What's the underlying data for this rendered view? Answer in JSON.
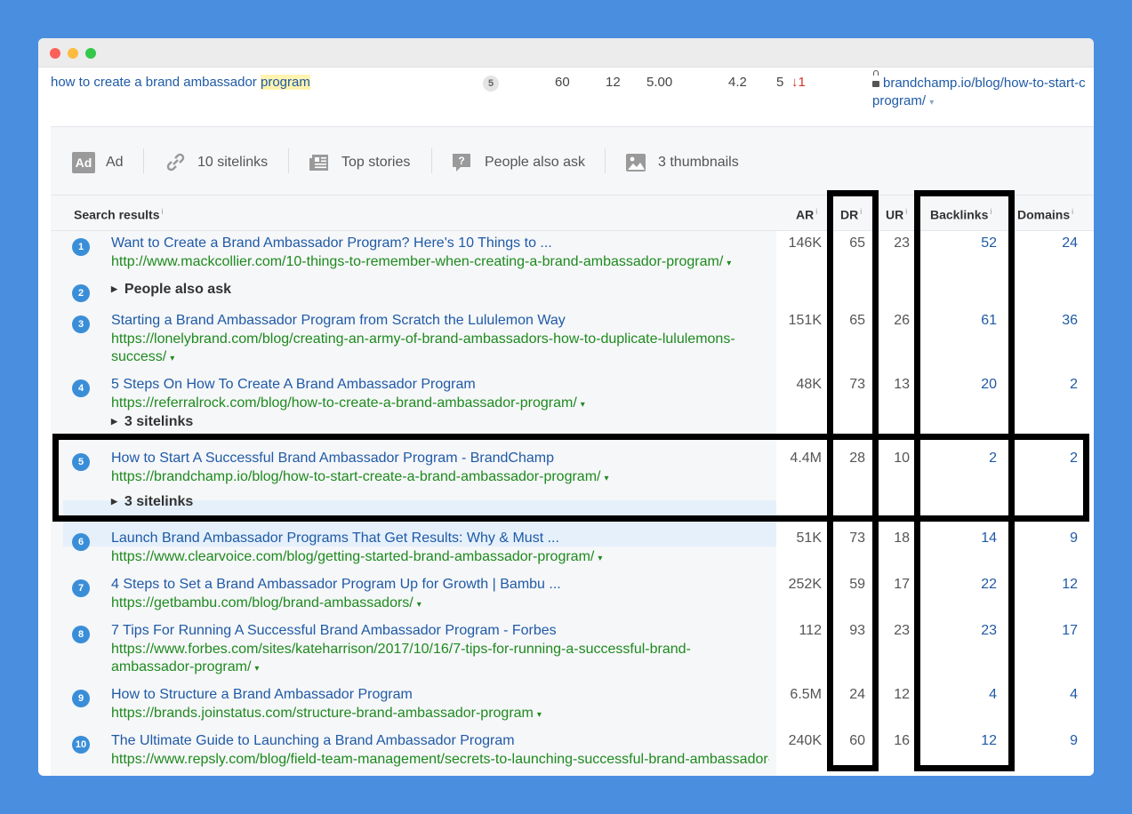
{
  "keyword_row": {
    "keyword_prefix": "how to create a brand ambassador ",
    "keyword_highlight": "program",
    "badge": "5",
    "values": [
      "60",
      "12",
      "5.00",
      "4.2",
      "5"
    ],
    "change": "↓1",
    "url_line1": "brandchamp.io/blog/how-to-start-c",
    "url_line2": "program/",
    "url_caret": "▾"
  },
  "serp_features": [
    {
      "label": "Ad",
      "icon": "ad-icon"
    },
    {
      "label": "10 sitelinks",
      "icon": "link-icon"
    },
    {
      "label": "Top stories",
      "icon": "news-icon"
    },
    {
      "label": "People also ask",
      "icon": "question-icon"
    },
    {
      "label": "3 thumbnails",
      "icon": "image-icon"
    }
  ],
  "ad_icon_text": "Ad",
  "columns": {
    "search_results": "Search results",
    "ar": "AR",
    "dr": "DR",
    "ur": "UR",
    "backlinks": "Backlinks",
    "domains": "Domains",
    "info": "i"
  },
  "results": [
    {
      "rank": "1",
      "title": "Want to Create a Brand Ambassador Program? Here's 10 Things to ...",
      "url": "http://www.mackcollier.com/10-things-to-remember-when-creating-a-brand-ambassador-program/",
      "ar": "146K",
      "dr": "65",
      "ur": "23",
      "backlinks": "52",
      "domains": "24"
    },
    {
      "rank": "2",
      "people_also_ask": "People also ask"
    },
    {
      "rank": "3",
      "title": "Starting a Brand Ambassador Program from Scratch the Lululemon Way",
      "url": "https://lonelybrand.com/blog/creating-an-army-of-brand-ambassadors-how-to-duplicate-lululemons-success/",
      "ar": "151K",
      "dr": "65",
      "ur": "26",
      "backlinks": "61",
      "domains": "36"
    },
    {
      "rank": "4",
      "title": "5 Steps On How To Create A Brand Ambassador Program",
      "url": "https://referralrock.com/blog/how-to-create-a-brand-ambassador-program/",
      "sitelinks": "3 sitelinks",
      "ar": "48K",
      "dr": "73",
      "ur": "13",
      "backlinks": "20",
      "domains": "2"
    },
    {
      "rank": "5",
      "title": "How to Start A Successful Brand Ambassador Program - BrandChamp",
      "url": "https://brandchamp.io/blog/how-to-start-create-a-brand-ambassador-program/",
      "sitelinks": "3 sitelinks",
      "ar": "4.4M",
      "dr": "28",
      "ur": "10",
      "backlinks": "2",
      "domains": "2"
    },
    {
      "rank": "6",
      "title": "Launch Brand Ambassador Programs That Get Results: Why & Must ...",
      "url": "https://www.clearvoice.com/blog/getting-started-brand-ambassador-program/",
      "ar": "51K",
      "dr": "73",
      "ur": "18",
      "backlinks": "14",
      "domains": "9"
    },
    {
      "rank": "7",
      "title": "4 Steps to Set a Brand Ambassador Program Up for Growth | Bambu ...",
      "url": "https://getbambu.com/blog/brand-ambassadors/",
      "ar": "252K",
      "dr": "59",
      "ur": "17",
      "backlinks": "22",
      "domains": "12"
    },
    {
      "rank": "8",
      "title": "7 Tips For Running A Successful Brand Ambassador Program - Forbes",
      "url": "https://www.forbes.com/sites/kateharrison/2017/10/16/7-tips-for-running-a-successful-brand-ambassador-program/",
      "ar": "112",
      "dr": "93",
      "ur": "23",
      "backlinks": "23",
      "domains": "17"
    },
    {
      "rank": "9",
      "title": "How to Structure a Brand Ambassador Program",
      "url": "https://brands.joinstatus.com/structure-brand-ambassador-program",
      "ar": "6.5M",
      "dr": "24",
      "ur": "12",
      "backlinks": "4",
      "domains": "4"
    },
    {
      "rank": "10",
      "title": "The Ultimate Guide to Launching a Brand Ambassador Program",
      "url": "https://www.repsly.com/blog/field-team-management/secrets-to-launching-successful-brand-ambassador-",
      "ar": "240K",
      "dr": "60",
      "ur": "16",
      "backlinks": "12",
      "domains": "9"
    }
  ],
  "dropdown_caret": "▾",
  "expand_caret": "▶",
  "colors": {
    "background": "#4a8ee0",
    "link": "#1f5aa6",
    "url": "#1e8a1e",
    "rank_badge": "#3a8ed8",
    "highlight_row": "#e5f0fb"
  }
}
